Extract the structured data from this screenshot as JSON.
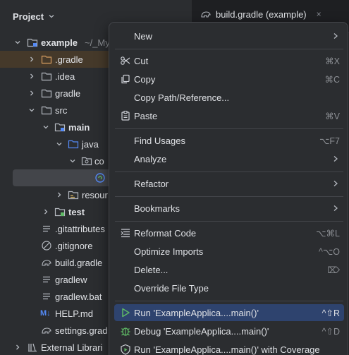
{
  "project_panel": {
    "title": "Project",
    "tree": [
      {
        "label": "example",
        "hint": "~/_My",
        "bold": true
      },
      {
        "label": ".gradle"
      },
      {
        "label": ".idea"
      },
      {
        "label": "gradle"
      },
      {
        "label": "src"
      },
      {
        "label": "main",
        "bold": true
      },
      {
        "label": "java"
      },
      {
        "label": "co"
      },
      {
        "label": ""
      },
      {
        "label": "resour"
      },
      {
        "label": "test",
        "bold": true
      },
      {
        "label": ".gitattributes"
      },
      {
        "label": ".gitignore"
      },
      {
        "label": "build.gradle"
      },
      {
        "label": "gradlew"
      },
      {
        "label": "gradlew.bat"
      },
      {
        "label": "HELP.md",
        "badge": "M↓"
      },
      {
        "label": "settings.grad"
      },
      {
        "label": "External Librari"
      }
    ]
  },
  "editor": {
    "tab_label": "build.gradle (example)",
    "tab_close": "×"
  },
  "context_menu": {
    "items": [
      {
        "label": "New",
        "shortcut": "",
        "submenu": true,
        "icon": ""
      },
      {
        "label": "Cut",
        "shortcut": "⌘X",
        "icon": "scissors-icon"
      },
      {
        "label": "Copy",
        "shortcut": "⌘C",
        "icon": "copy-icon"
      },
      {
        "label": "Copy Path/Reference...",
        "shortcut": "",
        "icon": ""
      },
      {
        "label": "Paste",
        "shortcut": "⌘V",
        "icon": "paste-icon"
      },
      {
        "label": "Find Usages",
        "shortcut": "⌥F7",
        "icon": ""
      },
      {
        "label": "Analyze",
        "shortcut": "",
        "submenu": true,
        "icon": ""
      },
      {
        "label": "Refactor",
        "shortcut": "",
        "submenu": true,
        "icon": ""
      },
      {
        "label": "Bookmarks",
        "shortcut": "",
        "submenu": true,
        "icon": ""
      },
      {
        "label": "Reformat Code",
        "shortcut": "⌥⌘L",
        "icon": "reformat-icon"
      },
      {
        "label": "Optimize Imports",
        "shortcut": "^⌥O",
        "icon": ""
      },
      {
        "label": "Delete...",
        "shortcut": "⌦",
        "icon": ""
      },
      {
        "label": "Override File Type",
        "shortcut": "",
        "icon": ""
      },
      {
        "label": "Run 'ExampleApplica....main()'",
        "shortcut": "^⇧R",
        "icon": "run-icon",
        "highlight": true
      },
      {
        "label": "Debug 'ExampleApplica....main()'",
        "shortcut": "^⇧D",
        "icon": "debug-icon"
      },
      {
        "label": "Run 'ExampleApplica....main()' with Coverage",
        "shortcut": "",
        "icon": "coverage-icon"
      }
    ]
  },
  "colors": {
    "background": "#2b2d30",
    "menu_highlight": "#2e436e",
    "gradle_folder_bg": "#45392a",
    "run_green": "#5fb865",
    "folder_blue": "#548af7"
  }
}
